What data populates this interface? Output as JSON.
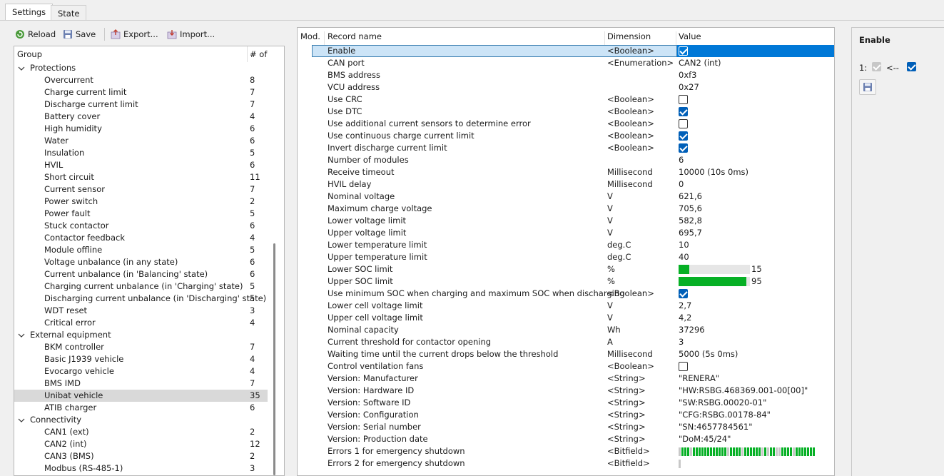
{
  "tabs": [
    {
      "label": "Settings"
    },
    {
      "label": "State"
    }
  ],
  "toolbar": {
    "reload_label": "Reload",
    "save_label": "Save",
    "export_label": "Export...",
    "import_label": "Import..."
  },
  "tree": {
    "col_group": "Group",
    "col_count": "# of",
    "groups": [
      {
        "name": "Protections",
        "items": [
          {
            "name": "Overcurrent",
            "count": "8"
          },
          {
            "name": "Charge current limit",
            "count": "7"
          },
          {
            "name": "Discharge current limit",
            "count": "7"
          },
          {
            "name": "Battery cover",
            "count": "4"
          },
          {
            "name": "High humidity",
            "count": "6"
          },
          {
            "name": "Water",
            "count": "6"
          },
          {
            "name": "Insulation",
            "count": "5"
          },
          {
            "name": "HVIL",
            "count": "6"
          },
          {
            "name": "Short circuit",
            "count": "11"
          },
          {
            "name": "Current sensor",
            "count": "7"
          },
          {
            "name": "Power switch",
            "count": "2"
          },
          {
            "name": "Power fault",
            "count": "5"
          },
          {
            "name": "Stuck contactor",
            "count": "6"
          },
          {
            "name": "Contactor feedback",
            "count": "4"
          },
          {
            "name": "Module offline",
            "count": "5"
          },
          {
            "name": "Voltage unbalance (in any state)",
            "count": "6"
          },
          {
            "name": "Current unbalance (in 'Balancing' state)",
            "count": "6"
          },
          {
            "name": "Charging current unbalance (in 'Charging' state)",
            "count": "5"
          },
          {
            "name": "Discharging current unbalance (in 'Discharging' state)",
            "count": "5"
          },
          {
            "name": "WDT reset",
            "count": "3"
          },
          {
            "name": "Critical error",
            "count": "4"
          }
        ]
      },
      {
        "name": "External equipment",
        "items": [
          {
            "name": "BKM controller",
            "count": "7"
          },
          {
            "name": "Basic J1939 vehicle",
            "count": "4"
          },
          {
            "name": "Evocargo vehicle",
            "count": "4"
          },
          {
            "name": "BMS IMD",
            "count": "7"
          },
          {
            "name": "Unibat vehicle",
            "count": "35",
            "selected": true
          },
          {
            "name": "ATIB charger",
            "count": "6"
          }
        ]
      },
      {
        "name": "Connectivity",
        "items": [
          {
            "name": "CAN1 (ext)",
            "count": "2"
          },
          {
            "name": "CAN2 (int)",
            "count": "12"
          },
          {
            "name": "CAN3 (BMS)",
            "count": "2"
          },
          {
            "name": "Modbus (RS-485-1)",
            "count": "3"
          }
        ]
      }
    ]
  },
  "grid": {
    "col_mod": "Mod.",
    "col_name": "Record name",
    "col_dim": "Dimension",
    "col_value": "Value",
    "rows": [
      {
        "name": "Enable",
        "dim": "<Boolean>",
        "kind": "bool",
        "checked": true,
        "selected": true
      },
      {
        "name": "CAN port",
        "dim": "<Enumeration>",
        "kind": "text",
        "value": "CAN2 (int)"
      },
      {
        "name": "BMS address",
        "dim": "",
        "kind": "text",
        "value": "0xf3"
      },
      {
        "name": "VCU address",
        "dim": "",
        "kind": "text",
        "value": "0x27"
      },
      {
        "name": "Use CRC",
        "dim": "<Boolean>",
        "kind": "bool",
        "checked": false
      },
      {
        "name": "Use DTC",
        "dim": "<Boolean>",
        "kind": "bool",
        "checked": true
      },
      {
        "name": "Use additional current sensors to determine error",
        "dim": "<Boolean>",
        "kind": "bool",
        "checked": false
      },
      {
        "name": "Use continuous charge current limit",
        "dim": "<Boolean>",
        "kind": "bool",
        "checked": true
      },
      {
        "name": "Invert discharge current limit",
        "dim": "<Boolean>",
        "kind": "bool",
        "checked": true
      },
      {
        "name": "Number of modules",
        "dim": "",
        "kind": "text",
        "value": "6"
      },
      {
        "name": "Receive timeout",
        "dim": "Millisecond",
        "kind": "text",
        "value": "10000 (10s 0ms)"
      },
      {
        "name": "HVIL delay",
        "dim": "Millisecond",
        "kind": "text",
        "value": "0"
      },
      {
        "name": "Nominal voltage",
        "dim": "V",
        "kind": "text",
        "value": "621,6"
      },
      {
        "name": "Maximum charge voltage",
        "dim": "V",
        "kind": "text",
        "value": "705,6"
      },
      {
        "name": "Lower voltage limit",
        "dim": "V",
        "kind": "text",
        "value": "582,8"
      },
      {
        "name": "Upper voltage limit",
        "dim": "V",
        "kind": "text",
        "value": "695,7"
      },
      {
        "name": "Lower temperature limit",
        "dim": "deg.C",
        "kind": "text",
        "value": "10"
      },
      {
        "name": "Upper temperature limit",
        "dim": "deg.C",
        "kind": "text",
        "value": "40"
      },
      {
        "name": "Lower SOC limit",
        "dim": "%",
        "kind": "bar",
        "value": "15",
        "percent": 15
      },
      {
        "name": "Upper SOC limit",
        "dim": "%",
        "kind": "bar",
        "value": "95",
        "percent": 95
      },
      {
        "name": "Use minimum SOC when charging and maximum SOC when discharging",
        "dim": "<Boolean>",
        "kind": "bool",
        "checked": true
      },
      {
        "name": "Lower cell voltage limit",
        "dim": "V",
        "kind": "text",
        "value": "2,7"
      },
      {
        "name": "Upper cell voltage limit",
        "dim": "V",
        "kind": "text",
        "value": "4,2"
      },
      {
        "name": "Nominal capacity",
        "dim": "Wh",
        "kind": "text",
        "value": "37296"
      },
      {
        "name": "Current threshold for contactor opening",
        "dim": "A",
        "kind": "text",
        "value": "3"
      },
      {
        "name": "Waiting time until the current drops below the threshold",
        "dim": "Millisecond",
        "kind": "text",
        "value": "5000 (5s 0ms)"
      },
      {
        "name": "Control ventilation fans",
        "dim": "<Boolean>",
        "kind": "bool",
        "checked": false
      },
      {
        "name": "Version: Manufacturer",
        "dim": "<String>",
        "kind": "text",
        "value": "\"RENERA\""
      },
      {
        "name": "Version: Hardware ID",
        "dim": "<String>",
        "kind": "text",
        "value": "\"HW:RSBG.468369.001-00[00]\""
      },
      {
        "name": "Version: Software ID",
        "dim": "<String>",
        "kind": "text",
        "value": "\"SW:RSBG.00020-01\""
      },
      {
        "name": "Version: Configuration",
        "dim": "<String>",
        "kind": "text",
        "value": "\"CFG:RSBG.00178-84\""
      },
      {
        "name": "Version: Serial number",
        "dim": "<String>",
        "kind": "text",
        "value": "\"SN:4657784561\""
      },
      {
        "name": "Version: Production date",
        "dim": "<String>",
        "kind": "text",
        "value": "\"DoM:45/24\""
      },
      {
        "name": "Errors 1 for emergency shutdown",
        "dim": "<Bitfield>",
        "kind": "bits",
        "bits": [
          0,
          1,
          1,
          1,
          0,
          1,
          1,
          1,
          1,
          1,
          1,
          1,
          1,
          1,
          1,
          1,
          1,
          0,
          1,
          1,
          1,
          1,
          0,
          1,
          1,
          1,
          1,
          1,
          1,
          0,
          1,
          0,
          1,
          1,
          0,
          0,
          1,
          1,
          1,
          1,
          0,
          1,
          1,
          1,
          1,
          1,
          1,
          1
        ]
      },
      {
        "name": "Errors 2 for emergency shutdown",
        "dim": "<Bitfield>",
        "kind": "bits",
        "bits": [
          0
        ]
      }
    ]
  },
  "right_panel": {
    "title": "Enable",
    "index_label": "1:",
    "arrow_label": "<--"
  },
  "colors": {
    "accent": "#0078d7",
    "bar_fill": "#06b025",
    "selected_row": "#cce4f7"
  }
}
